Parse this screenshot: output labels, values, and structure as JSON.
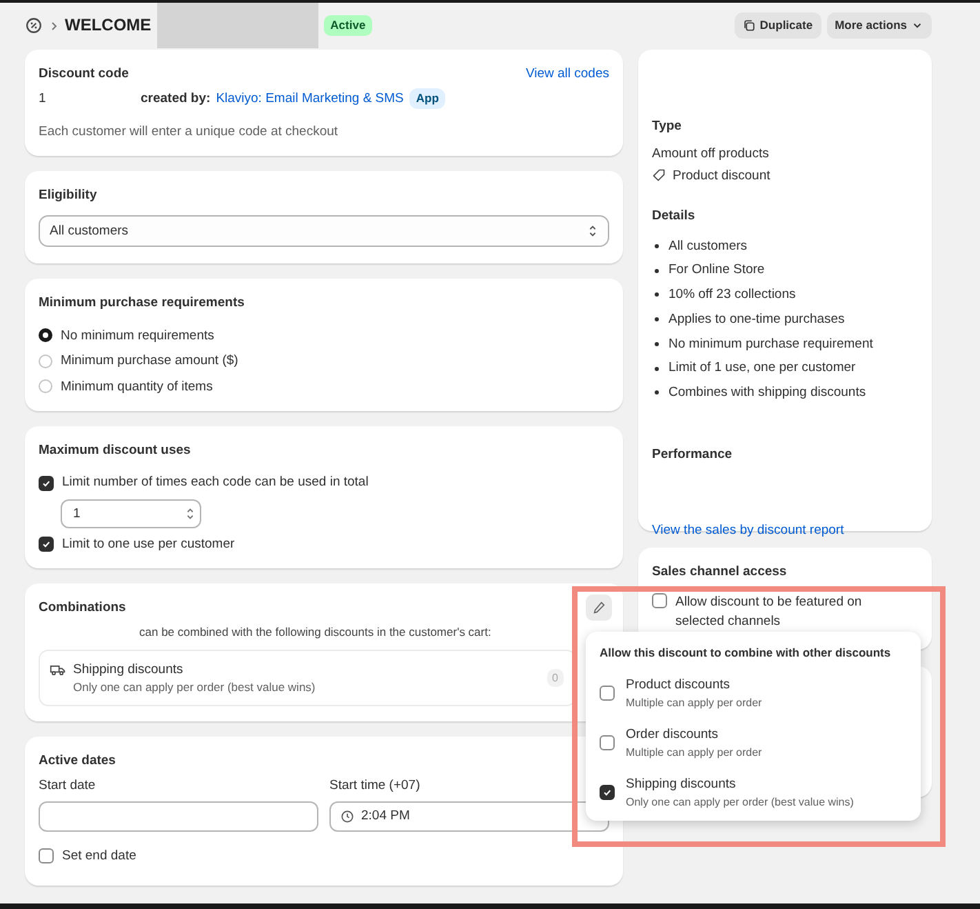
{
  "header": {
    "title": "WELCOME",
    "status": "Active",
    "buttons": [
      {
        "label": "Duplicate",
        "kind": "duplicate"
      },
      {
        "label": "More actions",
        "kind": "menu"
      }
    ]
  },
  "discount_code": {
    "title": "Discount code",
    "link": "View all codes",
    "code": "1",
    "created_by_label": "created by:",
    "creator": "Klaviyo: Email Marketing & SMS",
    "creator_badge": "App",
    "note": "Each customer will enter a unique code at checkout"
  },
  "eligibility": {
    "title": "Eligibility",
    "value": "All customers"
  },
  "minimum_requirements": {
    "title": "Minimum purchase requirements",
    "options": [
      {
        "label": "No minimum requirements",
        "selected": true
      },
      {
        "label": "Minimum purchase amount ($)",
        "selected": false
      },
      {
        "label": "Minimum quantity of items",
        "selected": false
      }
    ]
  },
  "maximum_uses": {
    "title": "Maximum discount uses",
    "options": [
      {
        "label": "Limit number of times each code can be used in total",
        "checked": true,
        "value": "1"
      },
      {
        "label": "Limit to one use per customer",
        "checked": true
      }
    ]
  },
  "combinations": {
    "title": "Combinations",
    "description": "can be combined with the following discounts in the customer's cart:",
    "items": [
      {
        "name": "Shipping discounts",
        "note": "Only one can apply per order (best value wins)",
        "count": "0"
      }
    ]
  },
  "active_dates": {
    "title": "Active dates",
    "start_date_label": "Start date",
    "start_time_label": "Start time (+07)",
    "start_time": "2:04 PM",
    "end_date": {
      "label": "Set end date",
      "checked": false
    }
  },
  "summary": {
    "type_title": "Type",
    "type": "Amount off products",
    "category": "Product discount",
    "details_title": "Details",
    "details": [
      "All customers",
      "For Online Store",
      "10% off 23 collections",
      "Applies to one-time purchases",
      "No minimum purchase requirement",
      "Limit of 1 use, one per customer",
      "Combines with shipping discounts"
    ],
    "performance_title": "Performance",
    "report_link": "View the sales by discount report"
  },
  "sales_channel": {
    "title": "Sales channel access",
    "option": {
      "label": "Allow discount to be featured on selected channels",
      "checked": false
    }
  },
  "combine_popover": {
    "title": "Allow this discount to combine with other discounts",
    "options": [
      {
        "label": "Product discounts",
        "note": "Multiple can apply per order",
        "checked": false
      },
      {
        "label": "Order discounts",
        "note": "Multiple can apply per order",
        "checked": false
      },
      {
        "label": "Shipping discounts",
        "note": "Only one can apply per order (best value wins)",
        "checked": true
      }
    ]
  }
}
